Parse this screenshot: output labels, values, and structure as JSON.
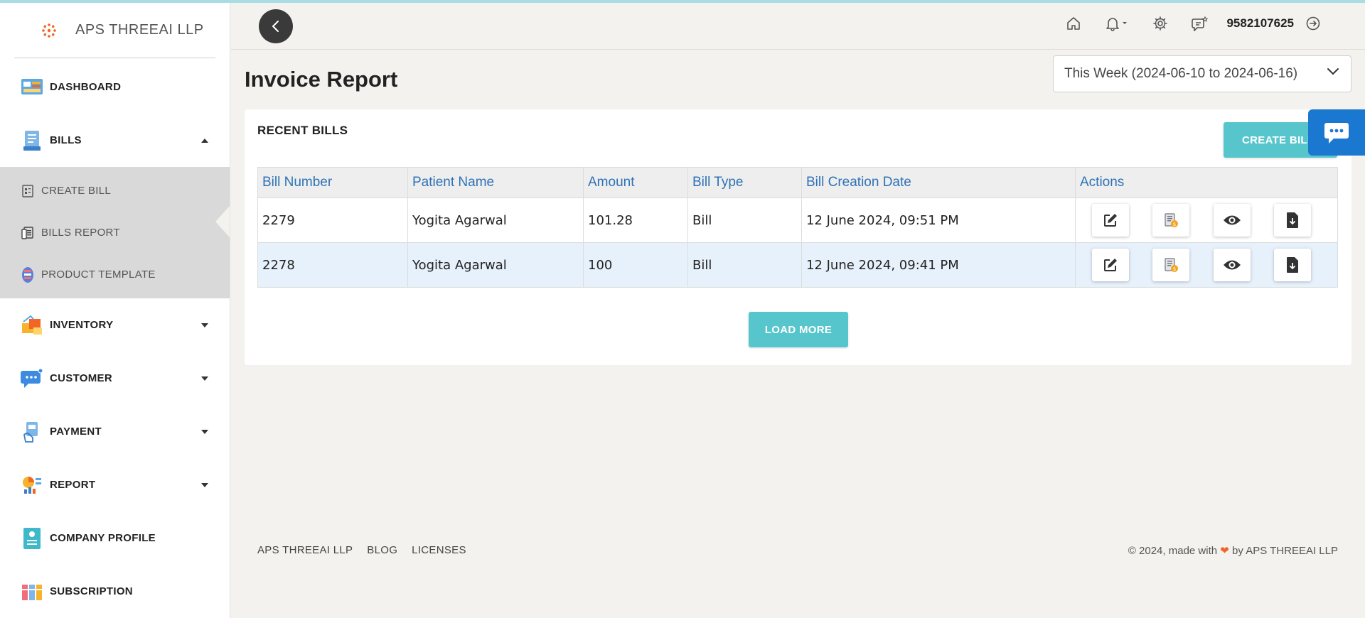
{
  "brand": {
    "name": "APS THREEAI LLP"
  },
  "sidebar": {
    "items": [
      {
        "label": "DASHBOARD"
      },
      {
        "label": "BILLS",
        "expanded": true,
        "sub": [
          {
            "label": "CREATE BILL"
          },
          {
            "label": "BILLS REPORT",
            "active": true
          },
          {
            "label": "PRODUCT TEMPLATE"
          }
        ]
      },
      {
        "label": "INVENTORY"
      },
      {
        "label": "CUSTOMER"
      },
      {
        "label": "PAYMENT"
      },
      {
        "label": "REPORT"
      },
      {
        "label": "COMPANY PROFILE"
      },
      {
        "label": "SUBSCRIPTION"
      }
    ]
  },
  "topbar": {
    "phone": "9582107625"
  },
  "main": {
    "title": "Invoice Report",
    "date_filter": "This Week (2024-06-10 to 2024-06-16)",
    "card_title": "RECENT BILLS",
    "create_label": "CREATE BILL",
    "load_more_label": "LOAD MORE"
  },
  "table": {
    "headers": [
      "Bill Number",
      "Patient Name",
      "Amount",
      "Bill Type",
      "Bill Creation Date",
      "Actions"
    ],
    "rows": [
      [
        "2279",
        "Yogita Agarwal",
        "101.28",
        "Bill",
        "12 June 2024, 09:51 PM"
      ],
      [
        "2278",
        "Yogita Agarwal",
        "100",
        "Bill",
        "12 June 2024, 09:41 PM"
      ]
    ]
  },
  "footer": {
    "links": [
      "APS THREEAI LLP",
      "BLOG",
      "LICENSES"
    ],
    "copy_prefix": "© 2024, made with",
    "copy_suffix": "by APS THREEAI LLP"
  },
  "colors": {
    "accent": "#56c6cc",
    "link_blue": "#2d72b6",
    "chat_blue": "#1b78d0",
    "heart": "#f26522"
  }
}
